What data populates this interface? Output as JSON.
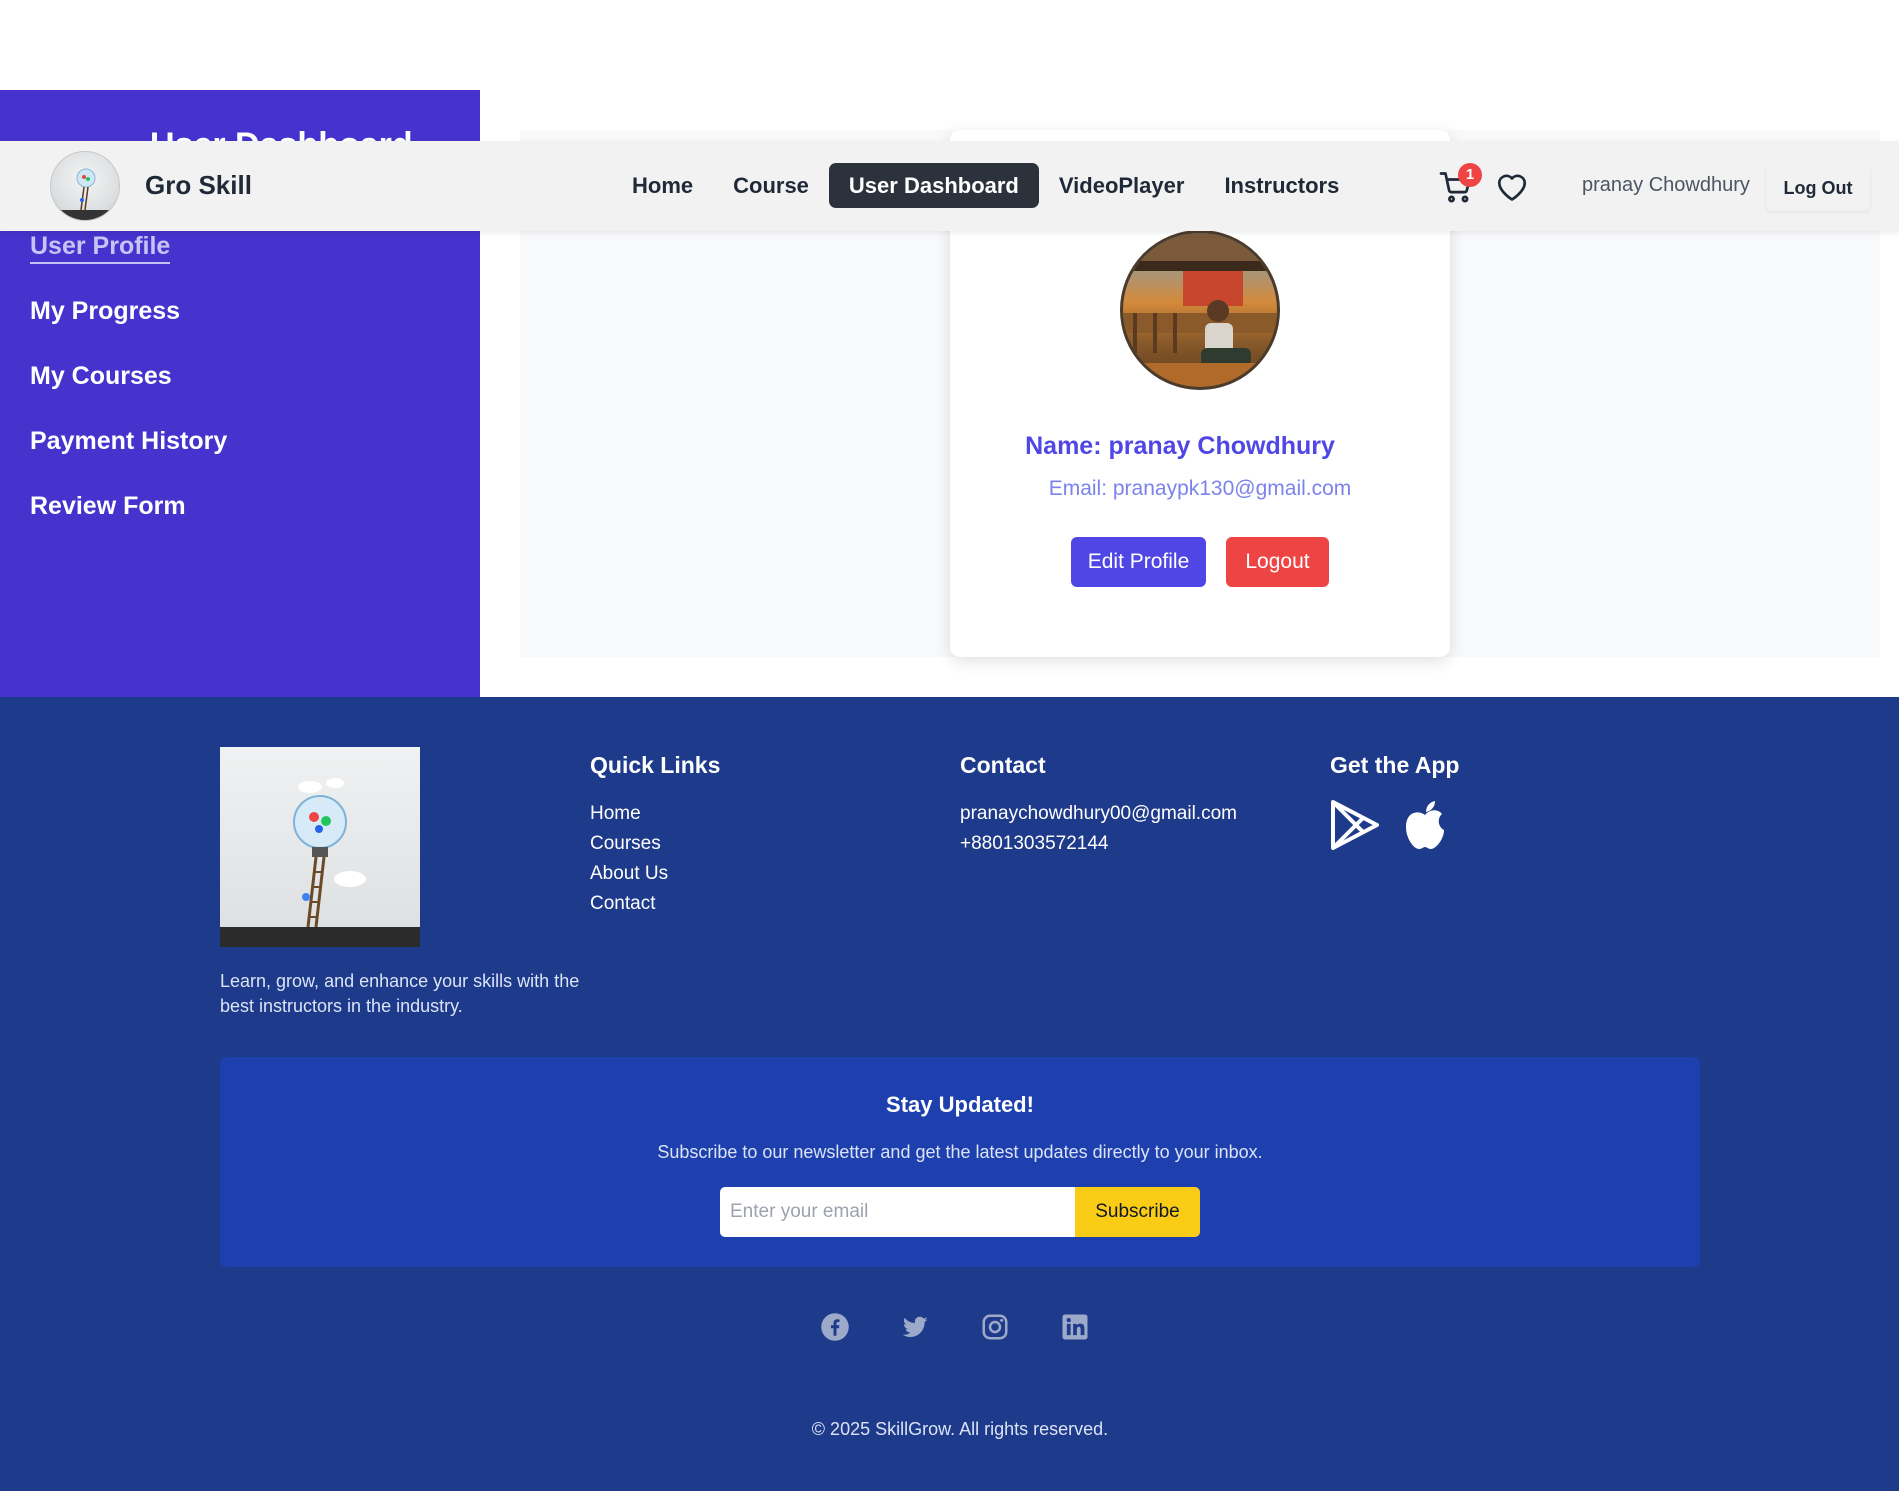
{
  "sidebar": {
    "title": "User Dashboard",
    "items": [
      {
        "label": "User Profile",
        "active": true
      },
      {
        "label": "My Progress"
      },
      {
        "label": "My Courses"
      },
      {
        "label": "Payment History"
      },
      {
        "label": "Review Form"
      }
    ]
  },
  "navbar": {
    "brand": "Gro Skill",
    "links": [
      {
        "label": "Home"
      },
      {
        "label": "Course"
      },
      {
        "label": "User Dashboard",
        "active": true
      },
      {
        "label": "VideoPlayer"
      },
      {
        "label": "Instructors"
      }
    ],
    "cart_count": "1",
    "user_name": "pranay Chowdhury",
    "logout_label": "Log Out",
    "cart_icon": "cart-icon",
    "wishlist_icon": "heart-icon"
  },
  "profile": {
    "name": "Name: pranay Chowdhury",
    "email": "Email: pranaypk130@gmail.com",
    "edit_label": "Edit Profile",
    "logout_label": "Logout"
  },
  "footer": {
    "tagline": "Learn, grow, and enhance your skills with the best instructors in the industry.",
    "quick_links": {
      "title": "Quick Links",
      "items": [
        "Home",
        "Courses",
        "About Us",
        "Contact"
      ]
    },
    "contact": {
      "title": "Contact",
      "email": "pranaychowdhury00@gmail.com",
      "phone": "+8801303572144"
    },
    "app": {
      "title": "Get the App",
      "icons": [
        "google-play-icon",
        "apple-icon"
      ]
    },
    "newsletter": {
      "title": "Stay Updated!",
      "subtitle": "Subscribe to our newsletter and get the latest updates directly to your inbox.",
      "placeholder": "Enter your email",
      "button": "Subscribe"
    },
    "socials": [
      "facebook-icon",
      "twitter-icon",
      "instagram-icon",
      "linkedin-icon"
    ],
    "copyright": "© 2025 SkillGrow. All rights reserved."
  },
  "colors": {
    "sidebar": "#4632cc",
    "accent": "#4f46e5",
    "danger": "#ef4444",
    "footer": "#1e3a8a",
    "newsletter": "#1e40af",
    "subscribe": "#facc15"
  }
}
